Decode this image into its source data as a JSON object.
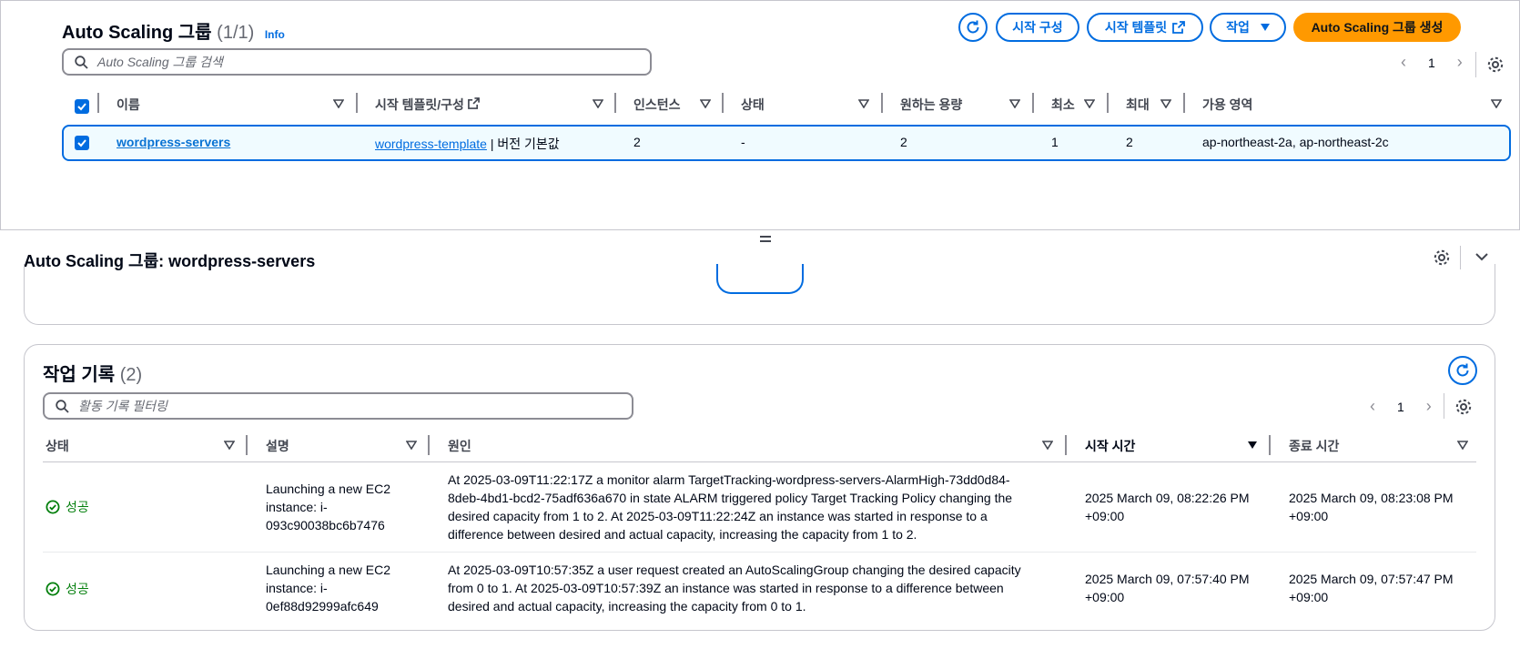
{
  "asg_panel": {
    "title": "Auto Scaling 그룹",
    "count": "(1/1)",
    "info": "Info",
    "buttons": {
      "launch_config": "시작 구성",
      "launch_template": "시작 템플릿",
      "actions": "작업",
      "create": "Auto Scaling 그룹 생성"
    },
    "search_placeholder": "Auto Scaling 그룹 검색",
    "page": "1",
    "columns": [
      "이름",
      "시작 템플릿/구성",
      "인스턴스",
      "상태",
      "원하는 용량",
      "최소",
      "최대",
      "가용 영역"
    ],
    "row": {
      "name": "wordpress-servers",
      "template": "wordpress-template",
      "template_suffix": " | 버전 기본값",
      "instances": "2",
      "status": "-",
      "desired": "2",
      "min": "1",
      "max": "2",
      "zones": "ap-northeast-2a, ap-northeast-2c"
    }
  },
  "detail": {
    "title": "Auto Scaling 그룹: wordpress-servers",
    "activity": {
      "title": "작업 기록",
      "count": "(2)",
      "search_placeholder": "활동 기록 필터링",
      "page": "1",
      "columns": [
        "상태",
        "설명",
        "원인",
        "시작 시간",
        "종료 시간"
      ],
      "rows": [
        {
          "status": "성공",
          "desc": [
            "Launching a new EC2",
            "instance: i-",
            "093c90038bc6b7476"
          ],
          "cause": [
            "At 2025-03-09T11:22:17Z a monitor alarm TargetTracking-wordpress-servers-AlarmHigh-73dd0d84-",
            "8deb-4bd1-bcd2-75adf636a670 in state ALARM triggered policy Target Tracking Policy changing the",
            "desired capacity from 1 to 2. At 2025-03-09T11:22:24Z an instance was started in response to a",
            "difference between desired and actual capacity, increasing the capacity from 1 to 2."
          ],
          "start": [
            "2025 March 09, 08:22:26 PM",
            "+09:00"
          ],
          "end": [
            "2025 March 09, 08:23:08 PM",
            "+09:00"
          ]
        },
        {
          "status": "성공",
          "desc": [
            "Launching a new EC2",
            "instance: i-",
            "0ef88d92999afc649"
          ],
          "cause": [
            "At 2025-03-09T10:57:35Z a user request created an AutoScalingGroup changing the desired capacity",
            "from 0 to 1. At 2025-03-09T10:57:39Z an instance was started in response to a difference between",
            "desired and actual capacity, increasing the capacity from 0 to 1."
          ],
          "start": [
            "2025 March 09, 07:57:40 PM",
            "+09:00"
          ],
          "end": [
            "2025 March 09, 07:57:47 PM",
            "+09:00"
          ]
        }
      ]
    }
  },
  "colors": {
    "accent": "#006ce0",
    "primary": "#ff9900",
    "success": "#037f0c"
  },
  "icons": [
    "refresh-icon",
    "external-link-icon",
    "caret-down-icon",
    "search-icon",
    "chevron-left-icon",
    "chevron-right-icon",
    "gear-icon",
    "checkbox-icon",
    "success-icon",
    "collapse-icon",
    "drag-handle-icon"
  ]
}
